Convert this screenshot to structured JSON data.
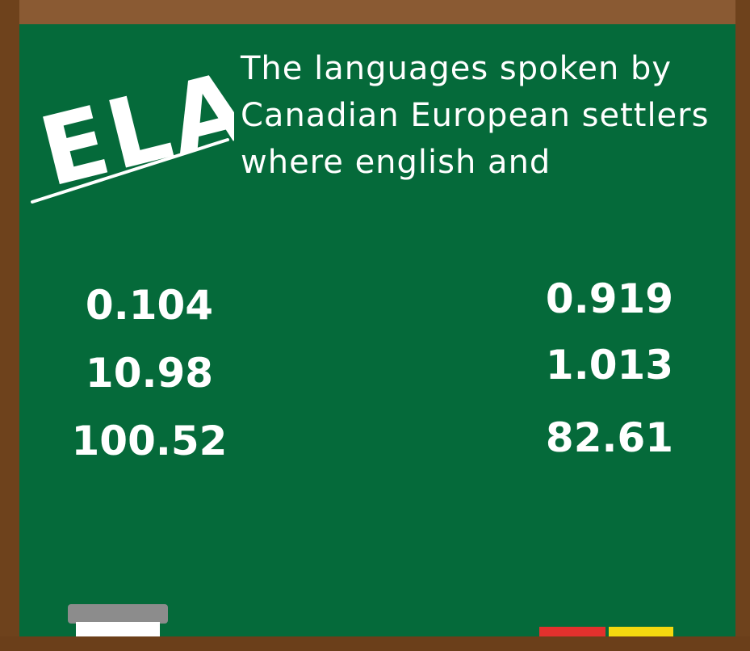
{
  "logo": {
    "text": "ELA"
  },
  "prompt": {
    "line1": "The languages spoken by",
    "line2": "Canadian European settlers",
    "line3": "where english and"
  },
  "options": {
    "left": [
      "0.104",
      "10.98",
      "100.52"
    ],
    "right": [
      "0.919",
      "1.013",
      "82.61"
    ]
  },
  "colors": {
    "board": "#056a3a",
    "frame": "#74461f",
    "chalk_text": "#ffffff",
    "chalk_red": "#e3312d",
    "chalk_yellow": "#f4d90f",
    "eraser": "#8c8c8c"
  },
  "icons": {
    "eraser": "eraser-icon",
    "chalk": "chalk-icon"
  }
}
